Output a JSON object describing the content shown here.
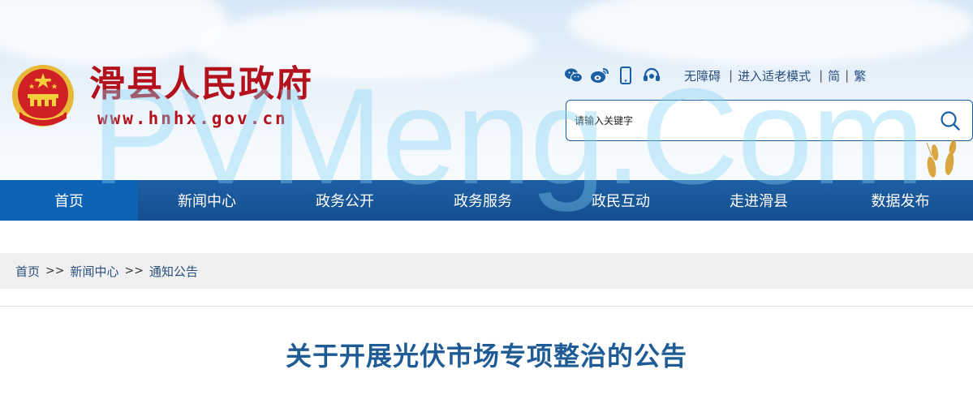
{
  "header": {
    "site_title": "滑县人民政府",
    "site_url": "www.hnhx.gov.cn",
    "brand_color": "#b3121d",
    "toolbar": {
      "icons": [
        "wechat-icon",
        "weibo-icon",
        "mobile-icon",
        "headset-icon"
      ],
      "links": {
        "accessibility": "无障碍",
        "elderly_mode": "进入适老模式",
        "simplified": "简",
        "traditional": "繁"
      },
      "separator": "|"
    },
    "search": {
      "placeholder": "请输入关键字"
    }
  },
  "nav": {
    "items": [
      "首页",
      "新闻中心",
      "政务公开",
      "政务服务",
      "政民互动",
      "走进滑县",
      "数据发布"
    ],
    "active_index": 0,
    "bg_color": "#144f8f"
  },
  "breadcrumb": {
    "items": [
      "首页",
      "新闻中心",
      "通知公告"
    ],
    "separator": ">>"
  },
  "article": {
    "title": "关于开展光伏市场专项整治的公告"
  },
  "watermark": "PVMeng.Com"
}
